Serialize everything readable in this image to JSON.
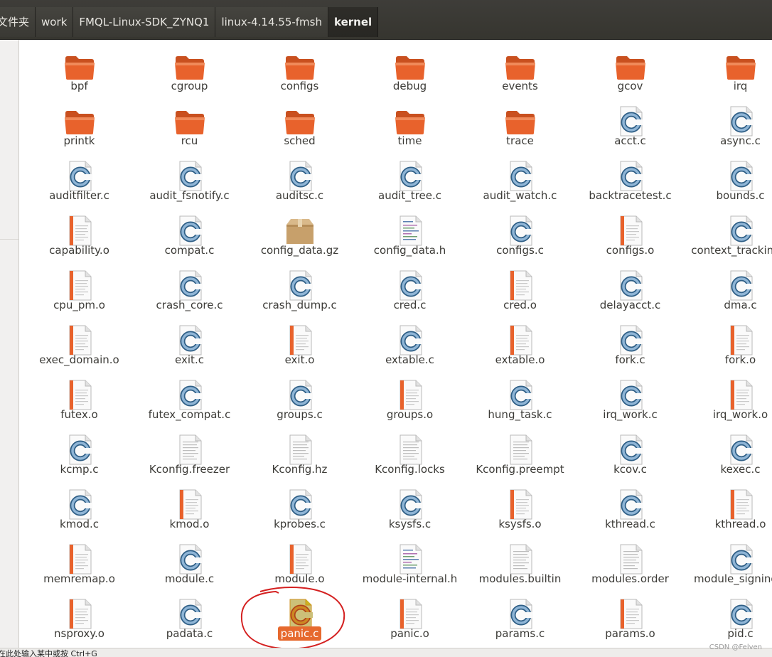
{
  "breadcrumb": [
    "文件夹",
    "work",
    "FMQL-Linux-SDK_ZYNQ1",
    "linux-4.14.55-fmsh",
    "kernel"
  ],
  "status_hint": "在此处输入某中或按 Ctrl+G",
  "watermark": "CSDN @Felven",
  "selected_file": "panic.c",
  "colors": {
    "folder": "#e8622c",
    "selection": "#e6692e",
    "c_icon": "#3a6f9a"
  },
  "files": [
    {
      "name": "bpf",
      "type": "folder"
    },
    {
      "name": "cgroup",
      "type": "folder"
    },
    {
      "name": "configs",
      "type": "folder"
    },
    {
      "name": "debug",
      "type": "folder"
    },
    {
      "name": "events",
      "type": "folder"
    },
    {
      "name": "gcov",
      "type": "folder"
    },
    {
      "name": "irq",
      "type": "folder"
    },
    {
      "name": "printk",
      "type": "folder"
    },
    {
      "name": "rcu",
      "type": "folder"
    },
    {
      "name": "sched",
      "type": "folder"
    },
    {
      "name": "time",
      "type": "folder"
    },
    {
      "name": "trace",
      "type": "folder"
    },
    {
      "name": "acct.c",
      "type": "c"
    },
    {
      "name": "async.c",
      "type": "c"
    },
    {
      "name": "auditfilter.c",
      "type": "c"
    },
    {
      "name": "audit_fsnotify.c",
      "type": "c"
    },
    {
      "name": "auditsc.c",
      "type": "c"
    },
    {
      "name": "audit_tree.c",
      "type": "c"
    },
    {
      "name": "audit_watch.c",
      "type": "c"
    },
    {
      "name": "backtracetest.c",
      "type": "c"
    },
    {
      "name": "bounds.c",
      "type": "c"
    },
    {
      "name": "capability.o",
      "type": "o"
    },
    {
      "name": "compat.c",
      "type": "c"
    },
    {
      "name": "config_data.gz",
      "type": "archive"
    },
    {
      "name": "config_data.h",
      "type": "h"
    },
    {
      "name": "configs.c",
      "type": "c"
    },
    {
      "name": "configs.o",
      "type": "o"
    },
    {
      "name": "context_tracking.c",
      "type": "c"
    },
    {
      "name": "cpu_pm.o",
      "type": "o"
    },
    {
      "name": "crash_core.c",
      "type": "c"
    },
    {
      "name": "crash_dump.c",
      "type": "c"
    },
    {
      "name": "cred.c",
      "type": "c"
    },
    {
      "name": "cred.o",
      "type": "o"
    },
    {
      "name": "delayacct.c",
      "type": "c"
    },
    {
      "name": "dma.c",
      "type": "c"
    },
    {
      "name": "exec_domain.o",
      "type": "o"
    },
    {
      "name": "exit.c",
      "type": "c"
    },
    {
      "name": "exit.o",
      "type": "o"
    },
    {
      "name": "extable.c",
      "type": "c"
    },
    {
      "name": "extable.o",
      "type": "o"
    },
    {
      "name": "fork.c",
      "type": "c"
    },
    {
      "name": "fork.o",
      "type": "o"
    },
    {
      "name": "futex.o",
      "type": "o"
    },
    {
      "name": "futex_compat.c",
      "type": "c"
    },
    {
      "name": "groups.c",
      "type": "c"
    },
    {
      "name": "groups.o",
      "type": "o"
    },
    {
      "name": "hung_task.c",
      "type": "c"
    },
    {
      "name": "irq_work.c",
      "type": "c"
    },
    {
      "name": "irq_work.o",
      "type": "o"
    },
    {
      "name": "kcmp.c",
      "type": "c"
    },
    {
      "name": "Kconfig.freezer",
      "type": "text"
    },
    {
      "name": "Kconfig.hz",
      "type": "text"
    },
    {
      "name": "Kconfig.locks",
      "type": "text"
    },
    {
      "name": "Kconfig.preempt",
      "type": "text"
    },
    {
      "name": "kcov.c",
      "type": "c"
    },
    {
      "name": "kexec.c",
      "type": "c"
    },
    {
      "name": "kmod.c",
      "type": "c"
    },
    {
      "name": "kmod.o",
      "type": "o"
    },
    {
      "name": "kprobes.c",
      "type": "c"
    },
    {
      "name": "ksysfs.c",
      "type": "c"
    },
    {
      "name": "ksysfs.o",
      "type": "o"
    },
    {
      "name": "kthread.c",
      "type": "c"
    },
    {
      "name": "kthread.o",
      "type": "o"
    },
    {
      "name": "memremap.o",
      "type": "o"
    },
    {
      "name": "module.c",
      "type": "c"
    },
    {
      "name": "module.o",
      "type": "o"
    },
    {
      "name": "module-internal.h",
      "type": "h"
    },
    {
      "name": "modules.builtin",
      "type": "text"
    },
    {
      "name": "modules.order",
      "type": "text"
    },
    {
      "name": "module_signing.c",
      "type": "c"
    },
    {
      "name": "nsproxy.o",
      "type": "o"
    },
    {
      "name": "padata.c",
      "type": "c"
    },
    {
      "name": "panic.c",
      "type": "c",
      "selected": true
    },
    {
      "name": "panic.o",
      "type": "o"
    },
    {
      "name": "params.c",
      "type": "c"
    },
    {
      "name": "params.o",
      "type": "o"
    },
    {
      "name": "pid.c",
      "type": "c"
    }
  ]
}
